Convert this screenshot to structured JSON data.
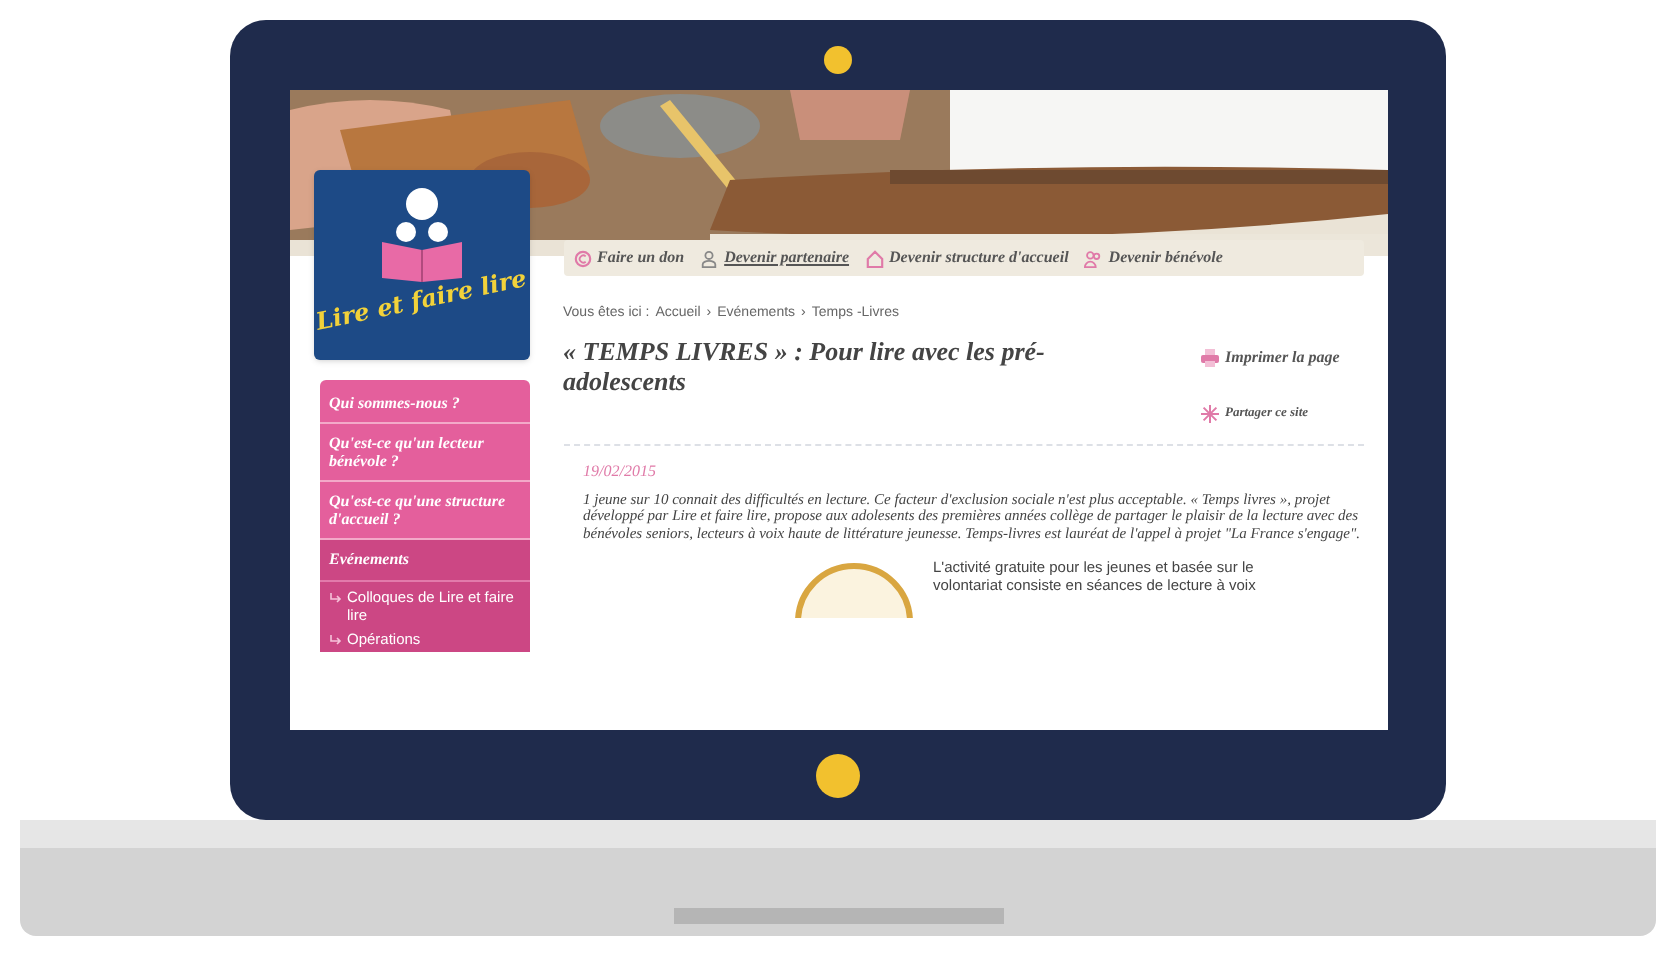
{
  "logo": {
    "text": "Lire et faire lire"
  },
  "action_links": [
    {
      "kind": "donate",
      "label": "Faire un don",
      "underlined": false
    },
    {
      "kind": "partner",
      "label": "Devenir partenaire",
      "underlined": true
    },
    {
      "kind": "host",
      "label": "Devenir structure d'accueil",
      "underlined": false
    },
    {
      "kind": "volunteer",
      "label": "Devenir bénévole",
      "underlined": false
    }
  ],
  "breadcrumb": {
    "prefix": "Vous êtes ici :",
    "separator": "›",
    "items": [
      "Accueil",
      "Evénements",
      "Temps -Livres"
    ]
  },
  "title": "« TEMPS LIVRES » : Pour lire avec les pré-adolescents",
  "tools": [
    {
      "kind": "print",
      "label": "Imprimer la page"
    },
    {
      "kind": "share",
      "label": "Partager ce site"
    }
  ],
  "sidebar": {
    "items": [
      {
        "kind": "link",
        "label": "Qui sommes-nous ?"
      },
      {
        "kind": "link",
        "label": "Qu'est-ce qu'un lecteur bénévole ?"
      },
      {
        "kind": "link",
        "label": "Qu'est-ce qu'une structure d'accueil ?"
      },
      {
        "kind": "section",
        "label": "Evénements",
        "children": [
          {
            "label": "Colloques de Lire et faire lire"
          },
          {
            "label": "Opérations"
          }
        ]
      }
    ]
  },
  "article": {
    "date": "19/02/2015",
    "text": "1 jeune sur 10 connait des difficultés en lecture. Ce facteur d'exclusion sociale n'est plus acceptable. « Temps livres », projet développé par Lire et faire lire, propose aux adolesents des premières années collège de partager le plaisir de la lecture avec des bénévoles seniors, lecteurs à voix haute de littérature jeunesse. Temps-livres est lauréat de l'appel à projet \"La France s'engage\".",
    "side_text": "L'activité gratuite pour les jeunes et basée sur le volontariat consiste en séances de lecture à voix"
  }
}
